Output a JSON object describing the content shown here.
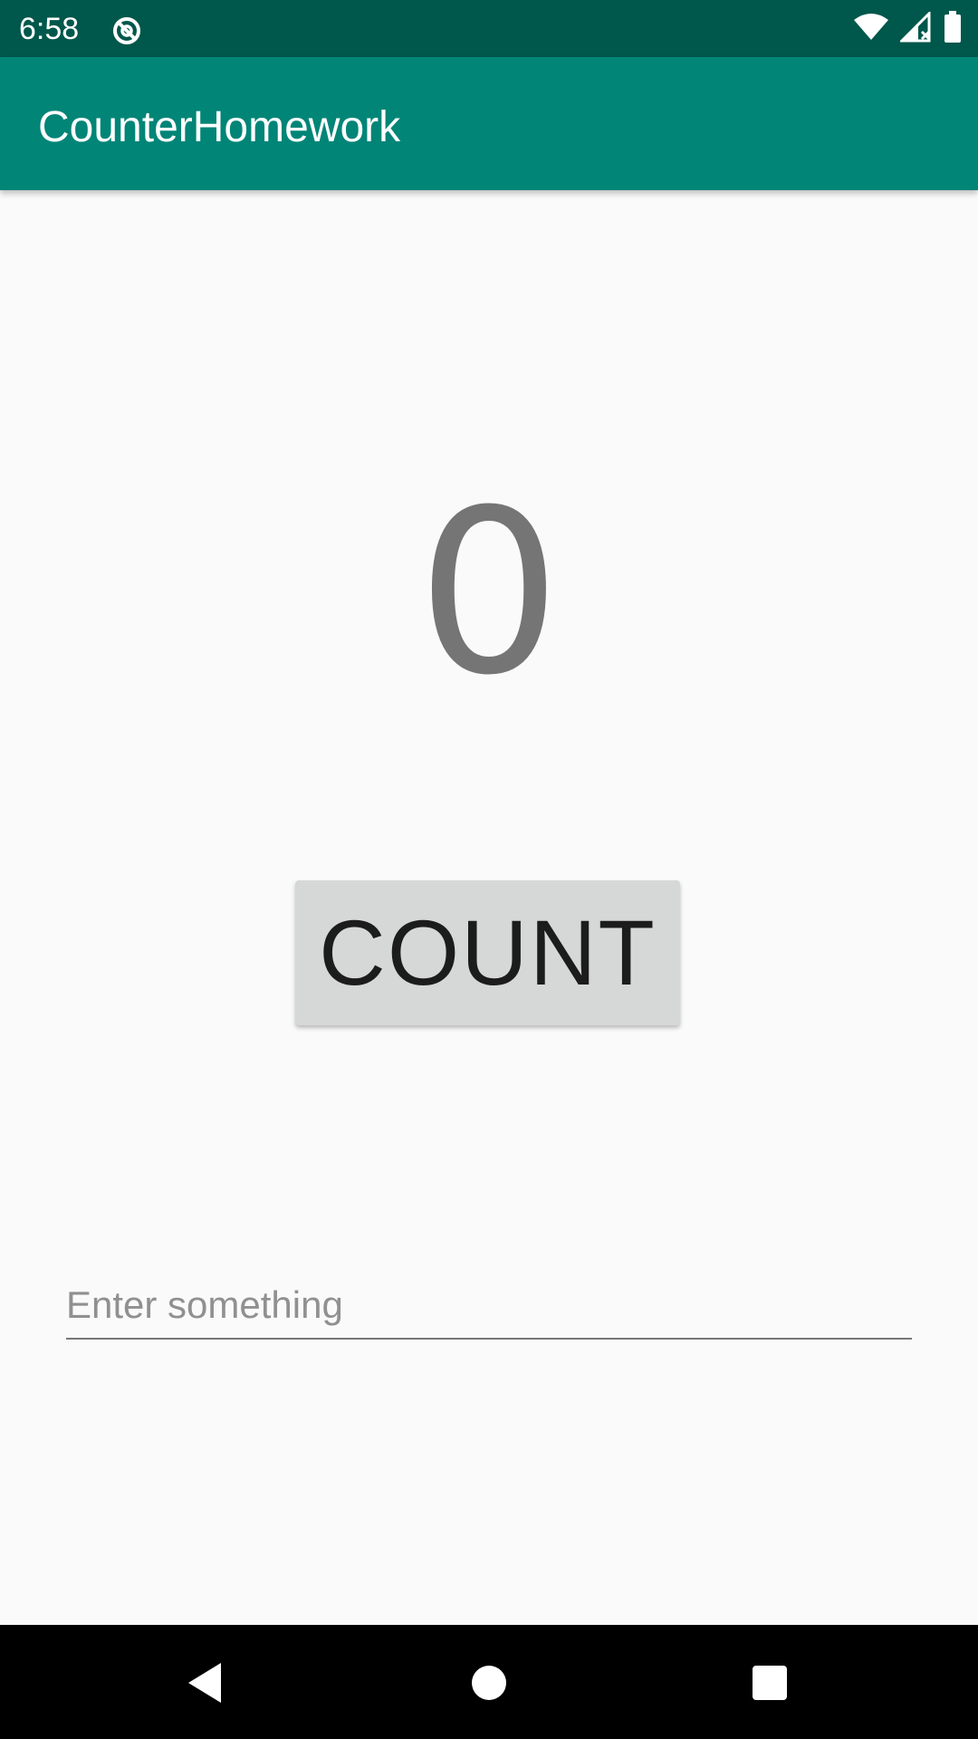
{
  "status_bar": {
    "time": "6:58",
    "icons": [
      "sync-icon",
      "wifi-icon",
      "cellular-signal-icon",
      "battery-icon"
    ],
    "background": "#00574b"
  },
  "app_bar": {
    "title": "CounterHomework",
    "background": "#008577"
  },
  "main": {
    "count_value": "0",
    "count_button_label": "COUNT",
    "input_placeholder": "Enter something",
    "input_value": ""
  },
  "nav_bar": {
    "buttons": [
      "back-icon",
      "home-icon",
      "recents-icon"
    ]
  }
}
